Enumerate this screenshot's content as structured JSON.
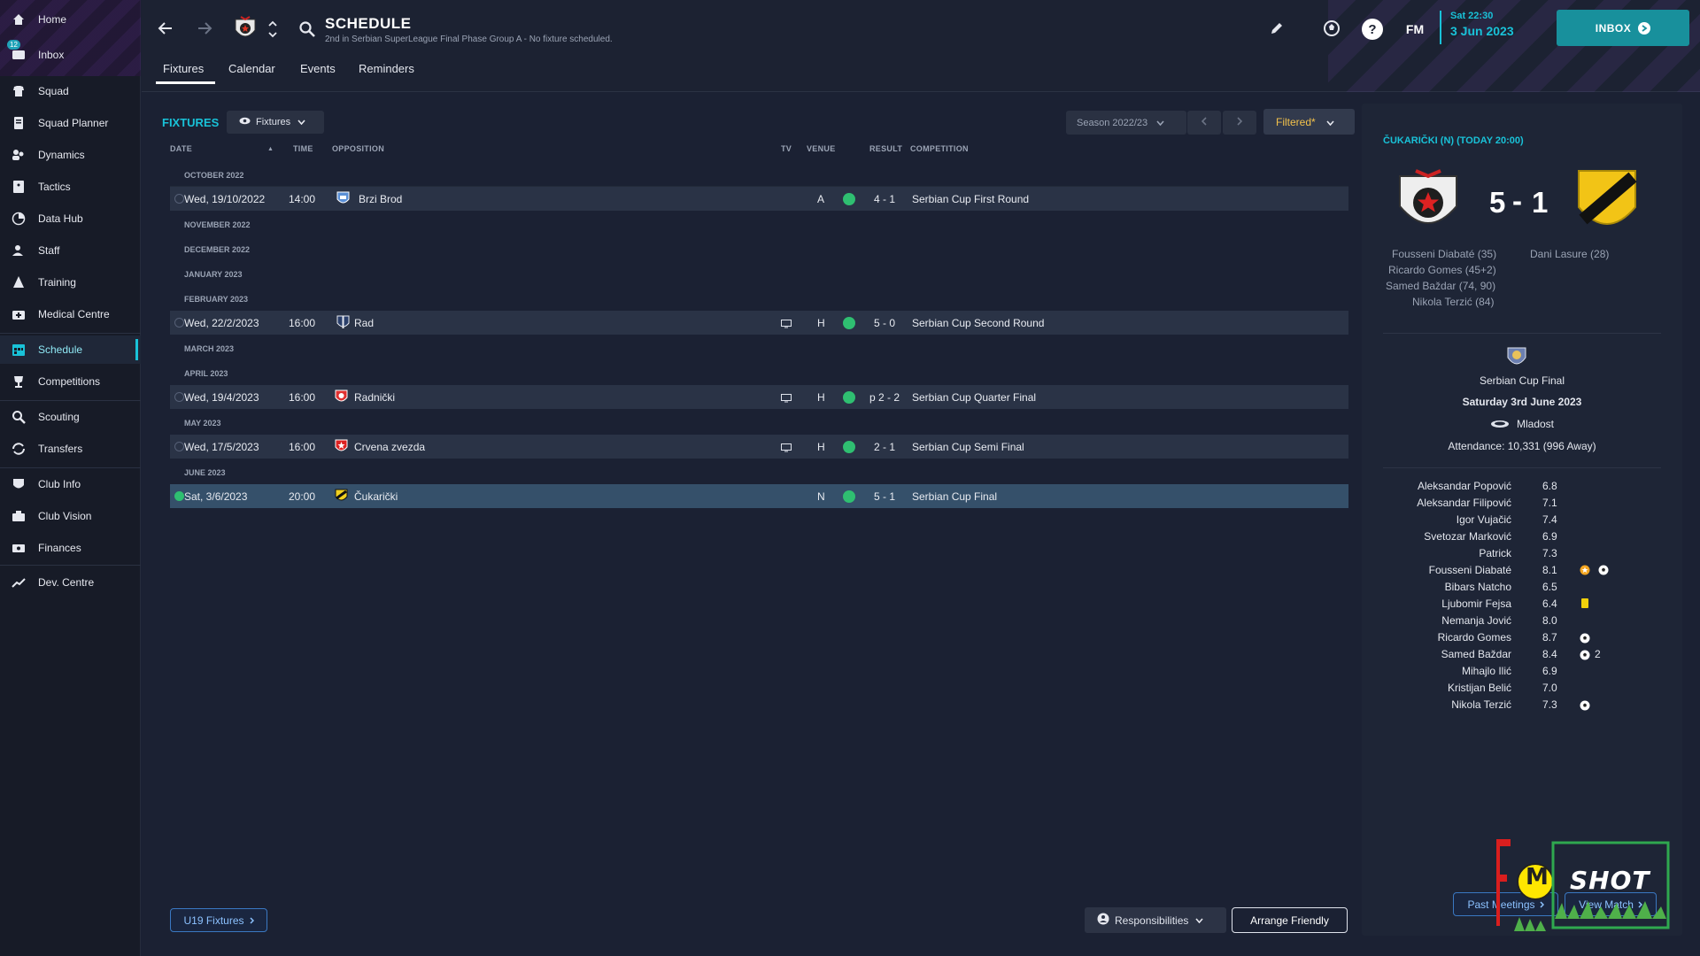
{
  "sidebar": {
    "items": [
      {
        "label": "Home",
        "icon": "home-icon"
      },
      {
        "label": "Inbox",
        "icon": "inbox-icon",
        "badge": "12"
      },
      {
        "label": "Squad",
        "icon": "squad-icon"
      },
      {
        "label": "Squad Planner",
        "icon": "squad-planner-icon"
      },
      {
        "label": "Dynamics",
        "icon": "dynamics-icon"
      },
      {
        "label": "Tactics",
        "icon": "tactics-icon"
      },
      {
        "label": "Data Hub",
        "icon": "data-hub-icon"
      },
      {
        "label": "Staff",
        "icon": "staff-icon"
      },
      {
        "label": "Training",
        "icon": "training-icon"
      },
      {
        "label": "Medical Centre",
        "icon": "medical-icon"
      },
      {
        "label": "Schedule",
        "icon": "schedule-icon",
        "active": true
      },
      {
        "label": "Competitions",
        "icon": "trophy-icon"
      },
      {
        "label": "Scouting",
        "icon": "scouting-icon"
      },
      {
        "label": "Transfers",
        "icon": "transfers-icon"
      },
      {
        "label": "Club Info",
        "icon": "club-info-icon"
      },
      {
        "label": "Club Vision",
        "icon": "club-vision-icon"
      },
      {
        "label": "Finances",
        "icon": "finances-icon"
      },
      {
        "label": "Dev. Centre",
        "icon": "dev-centre-icon"
      }
    ]
  },
  "header": {
    "title": "SCHEDULE",
    "subtitle": "2nd in Serbian SuperLeague Final Phase Group A - No fixture scheduled.",
    "fm_label": "FM",
    "date_time": "Sat 22:30",
    "date": "3 Jun 2023",
    "inbox_label": "INBOX"
  },
  "tabs": [
    "Fixtures",
    "Calendar",
    "Events",
    "Reminders"
  ],
  "fixtures": {
    "title": "FIXTURES",
    "view_dropdown": "Fixtures",
    "season": "Season 2022/23",
    "filter": "Filtered*",
    "columns": {
      "date": "DATE",
      "time": "TIME",
      "opposition": "OPPOSITION",
      "tv": "TV",
      "venue": "VENUE",
      "result": "RESULT",
      "competition": "COMPETITION"
    },
    "months": {
      "oct": "OCTOBER 2022",
      "nov": "NOVEMBER 2022",
      "dec": "DECEMBER 2022",
      "jan": "JANUARY 2023",
      "feb": "FEBRUARY 2023",
      "mar": "MARCH 2023",
      "apr": "APRIL 2023",
      "may": "MAY 2023",
      "jun": "JUNE 2023"
    },
    "rows": [
      {
        "date": "Wed, 19/10/2022",
        "time": "14:00",
        "opposition": "Brzi Brod",
        "tv": false,
        "venue": "A",
        "result": "4 - 1",
        "competition": "Serbian Cup First Round"
      },
      {
        "date": "Wed, 22/2/2023",
        "time": "16:00",
        "opposition": "Rad",
        "tv": true,
        "venue": "H",
        "result": "5 - 0",
        "competition": "Serbian Cup Second Round"
      },
      {
        "date": "Wed, 19/4/2023",
        "time": "16:00",
        "opposition": "Radnički",
        "tv": true,
        "venue": "H",
        "result": "p 2 - 2",
        "competition": "Serbian Cup Quarter Final"
      },
      {
        "date": "Wed, 17/5/2023",
        "time": "16:00",
        "opposition": "Crvena zvezda",
        "tv": true,
        "venue": "H",
        "result": "2 - 1",
        "competition": "Serbian Cup Semi Final"
      },
      {
        "date": "Sat, 3/6/2023",
        "time": "20:00",
        "opposition": "Čukarički",
        "tv": false,
        "venue": "N",
        "result": "5 - 1",
        "competition": "Serbian Cup Final"
      }
    ],
    "u19_button": "U19 Fixtures",
    "responsibilities_button": "Responsibilities",
    "arrange_button": "Arrange Friendly"
  },
  "match_panel": {
    "header": "ČUKARIČKI (N) (TODAY 20:00)",
    "home_score": "5",
    "dash": "-",
    "away_score": "1",
    "home_scorers": [
      "Fousseni Diabaté (35)",
      "Ricardo Gomes (45+2)",
      "Samed Baždar (74, 90)",
      "Nikola Terzić (84)"
    ],
    "away_scorers": [
      "Dani Lasure (28)"
    ],
    "competition": "Serbian Cup Final",
    "match_date": "Saturday 3rd June 2023",
    "stadium": "Mladost",
    "attendance": "Attendance: 10,331 (996 Away)",
    "players": [
      {
        "name": "Aleksandar Popović",
        "rating": "6.8",
        "events": ""
      },
      {
        "name": "Aleksandar Filipović",
        "rating": "7.1",
        "events": ""
      },
      {
        "name": "Igor Vujačić",
        "rating": "7.4",
        "events": ""
      },
      {
        "name": "Svetozar Marković",
        "rating": "6.9",
        "events": ""
      },
      {
        "name": "Patrick",
        "rating": "7.3",
        "events": ""
      },
      {
        "name": "Fousseni Diabaté",
        "rating": "8.1",
        "events": "motm-goal"
      },
      {
        "name": "Bibars Natcho",
        "rating": "6.5",
        "events": ""
      },
      {
        "name": "Ljubomir Fejsa",
        "rating": "6.4",
        "events": "yellow"
      },
      {
        "name": "Nemanja Jović",
        "rating": "8.0",
        "events": ""
      },
      {
        "name": "Ricardo Gomes",
        "rating": "8.7",
        "events": "goal"
      },
      {
        "name": "Samed Baždar",
        "rating": "8.4",
        "events": "goal2"
      },
      {
        "name": "Mihajlo Ilić",
        "rating": "6.9",
        "events": ""
      },
      {
        "name": "Kristijan Belić",
        "rating": "7.0",
        "events": ""
      },
      {
        "name": "Nikola Terzić",
        "rating": "7.3",
        "events": "goal"
      }
    ],
    "goal_count_label": "2",
    "past_meetings_button": "Past Meetings",
    "view_match_button": "View Match"
  },
  "watermark": {
    "text": "SHOT",
    "letter": "M"
  },
  "colors": {
    "accent": "#19c2d8",
    "win": "#2fbf71",
    "yellow_card": "#f1d10b",
    "motm": "#f3a623"
  }
}
